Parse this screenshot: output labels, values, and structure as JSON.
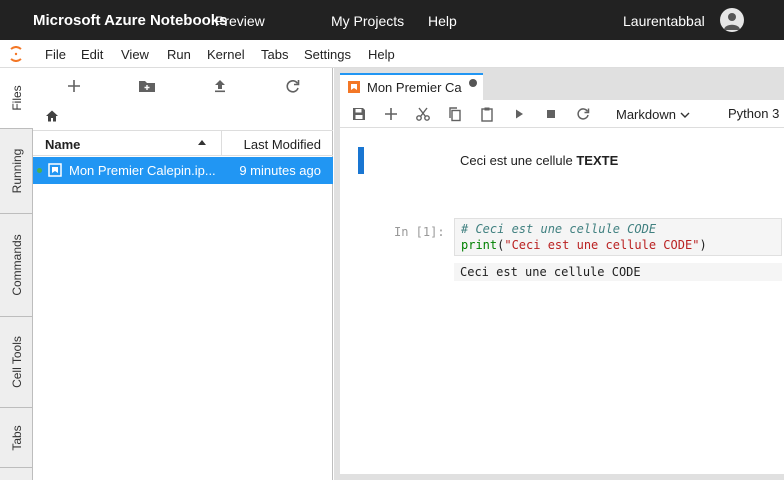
{
  "topbar": {
    "brand": "Microsoft Azure Notebooks",
    "preview": "Preview",
    "nav_projects": "My Projects",
    "nav_help": "Help",
    "username": "Laurentabbal"
  },
  "menu": [
    "File",
    "Edit",
    "View",
    "Run",
    "Kernel",
    "Tabs",
    "Settings",
    "Help"
  ],
  "side_tabs": [
    "Files",
    "Running",
    "Commands",
    "Cell Tools",
    "Tabs"
  ],
  "filebrowser": {
    "columns": {
      "name": "Name",
      "modified": "Last Modified"
    },
    "rows": [
      {
        "name": "Mon Premier Calepin.ip...",
        "modified": "9 minutes ago"
      }
    ]
  },
  "doc_tab": {
    "label": "Mon Premier Calepin.ipynb"
  },
  "notebook_toolbar": {
    "cell_type": "Markdown",
    "kernel": "Python 3"
  },
  "cells": {
    "markdown": {
      "text_plain": "Ceci est une cellule ",
      "text_bold": "TEXTE"
    },
    "code": {
      "prompt": "In [1]:",
      "comment": "# Ceci est une cellule CODE",
      "builtin": "print",
      "open_paren": "(",
      "string": "\"Ceci est une cellule CODE\"",
      "close_paren": ")",
      "output": "Ceci est une cellule CODE"
    }
  },
  "colors": {
    "accent": "#2196f3",
    "topbar": "#222222",
    "logo": "#f37726"
  }
}
